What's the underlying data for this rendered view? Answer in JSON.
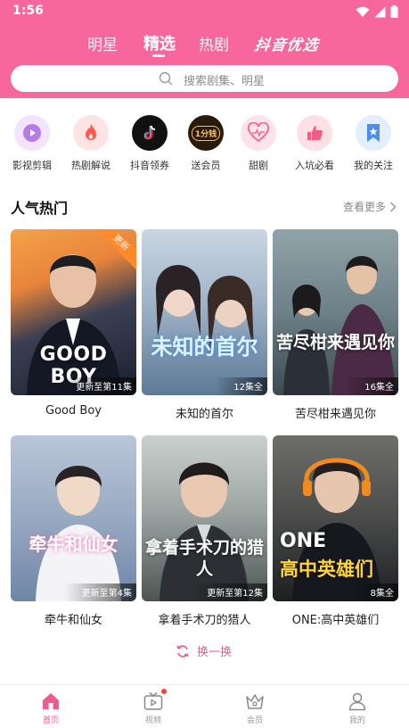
{
  "status_bar": {
    "time": "1:56"
  },
  "header": {
    "tabs": [
      {
        "label": "明星"
      },
      {
        "label": "精选",
        "active": true
      },
      {
        "label": "热剧"
      }
    ],
    "brand_tab": "抖音优选",
    "accent_color": "#f8679b"
  },
  "search": {
    "placeholder": "搜索剧集、明星"
  },
  "categories": [
    {
      "label": "影视剪辑",
      "icon": "video-play-icon"
    },
    {
      "label": "热剧解说",
      "icon": "fire-icon"
    },
    {
      "label": "抖音领券",
      "icon": "douyin-coupon-icon"
    },
    {
      "label": "送会员",
      "icon": "one-cent-membership-icon",
      "icon_text": "1分钱"
    },
    {
      "label": "甜剧",
      "icon": "heart-icon"
    },
    {
      "label": "入坑必看",
      "icon": "thumbs-up-icon"
    },
    {
      "label": "我的关注",
      "icon": "star-bookmark-icon"
    }
  ],
  "section": {
    "title": "人气热门",
    "more_label": "查看更多"
  },
  "cards": [
    {
      "name": "Good Boy",
      "poster_title": "GOOD BOY",
      "episode_badge": "更新至第11集",
      "corner_tag": "更新"
    },
    {
      "name": "未知的首尔",
      "poster_title": "未知的首尔",
      "episode_badge": "12集全"
    },
    {
      "name": "苦尽柑来遇见你",
      "poster_title": "苦尽柑来遇见你",
      "episode_badge": "16集全"
    },
    {
      "name": "牵牛和仙女",
      "poster_title": "牵牛和仙女",
      "episode_badge": "更新至第4集"
    },
    {
      "name": "拿着手术刀的猎人",
      "poster_title": "拿着手术刀的猎人",
      "episode_badge": "更新至第12集"
    },
    {
      "name": "ONE:高中英雄们",
      "poster_title_line1": "ONE",
      "poster_title_line2": "高中英雄们",
      "episode_badge": "8集全"
    }
  ],
  "refresh_label": "换一换",
  "bottom_nav": [
    {
      "label": "首页",
      "icon": "home-icon",
      "active": true
    },
    {
      "label": "视频",
      "icon": "tv-icon",
      "has_dot": true
    },
    {
      "label": "会员",
      "icon": "crown-icon"
    },
    {
      "label": "我的",
      "icon": "person-icon"
    }
  ]
}
